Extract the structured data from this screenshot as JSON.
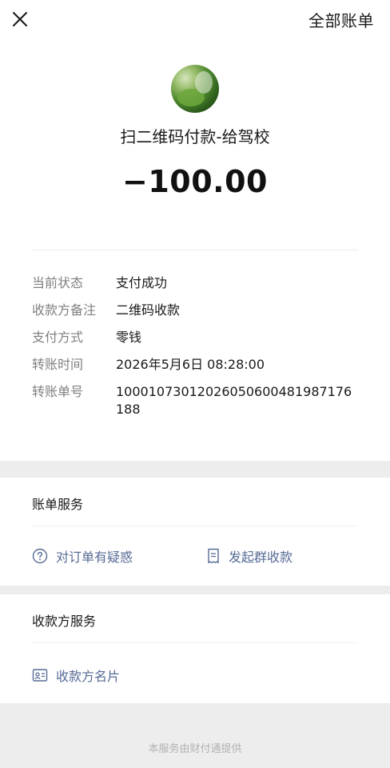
{
  "nav": {
    "right_label": "全部账单"
  },
  "payment": {
    "merchant": "扫二维码付款-给驾校",
    "amount": "−100.00"
  },
  "details": [
    {
      "label": "当前状态",
      "value": "支付成功"
    },
    {
      "label": "收款方备注",
      "value": "二维码收款"
    },
    {
      "label": "支付方式",
      "value": "零钱"
    },
    {
      "label": "转账时间",
      "value": "2026年5月6日 08:28:00"
    },
    {
      "label": "转账单号",
      "value": "100010730120260506004819871761​88"
    }
  ],
  "bill_service": {
    "title": "账单服务",
    "inquiry_label": "对订单有疑惑",
    "group_collect_label": "发起群收款"
  },
  "payee_service": {
    "title": "收款方服务",
    "card_label": "收款方名片"
  },
  "footer": "本服务由财付通提供",
  "colors": {
    "link": "#576b95",
    "label": "#7f7f7f",
    "background": "#ededed"
  }
}
